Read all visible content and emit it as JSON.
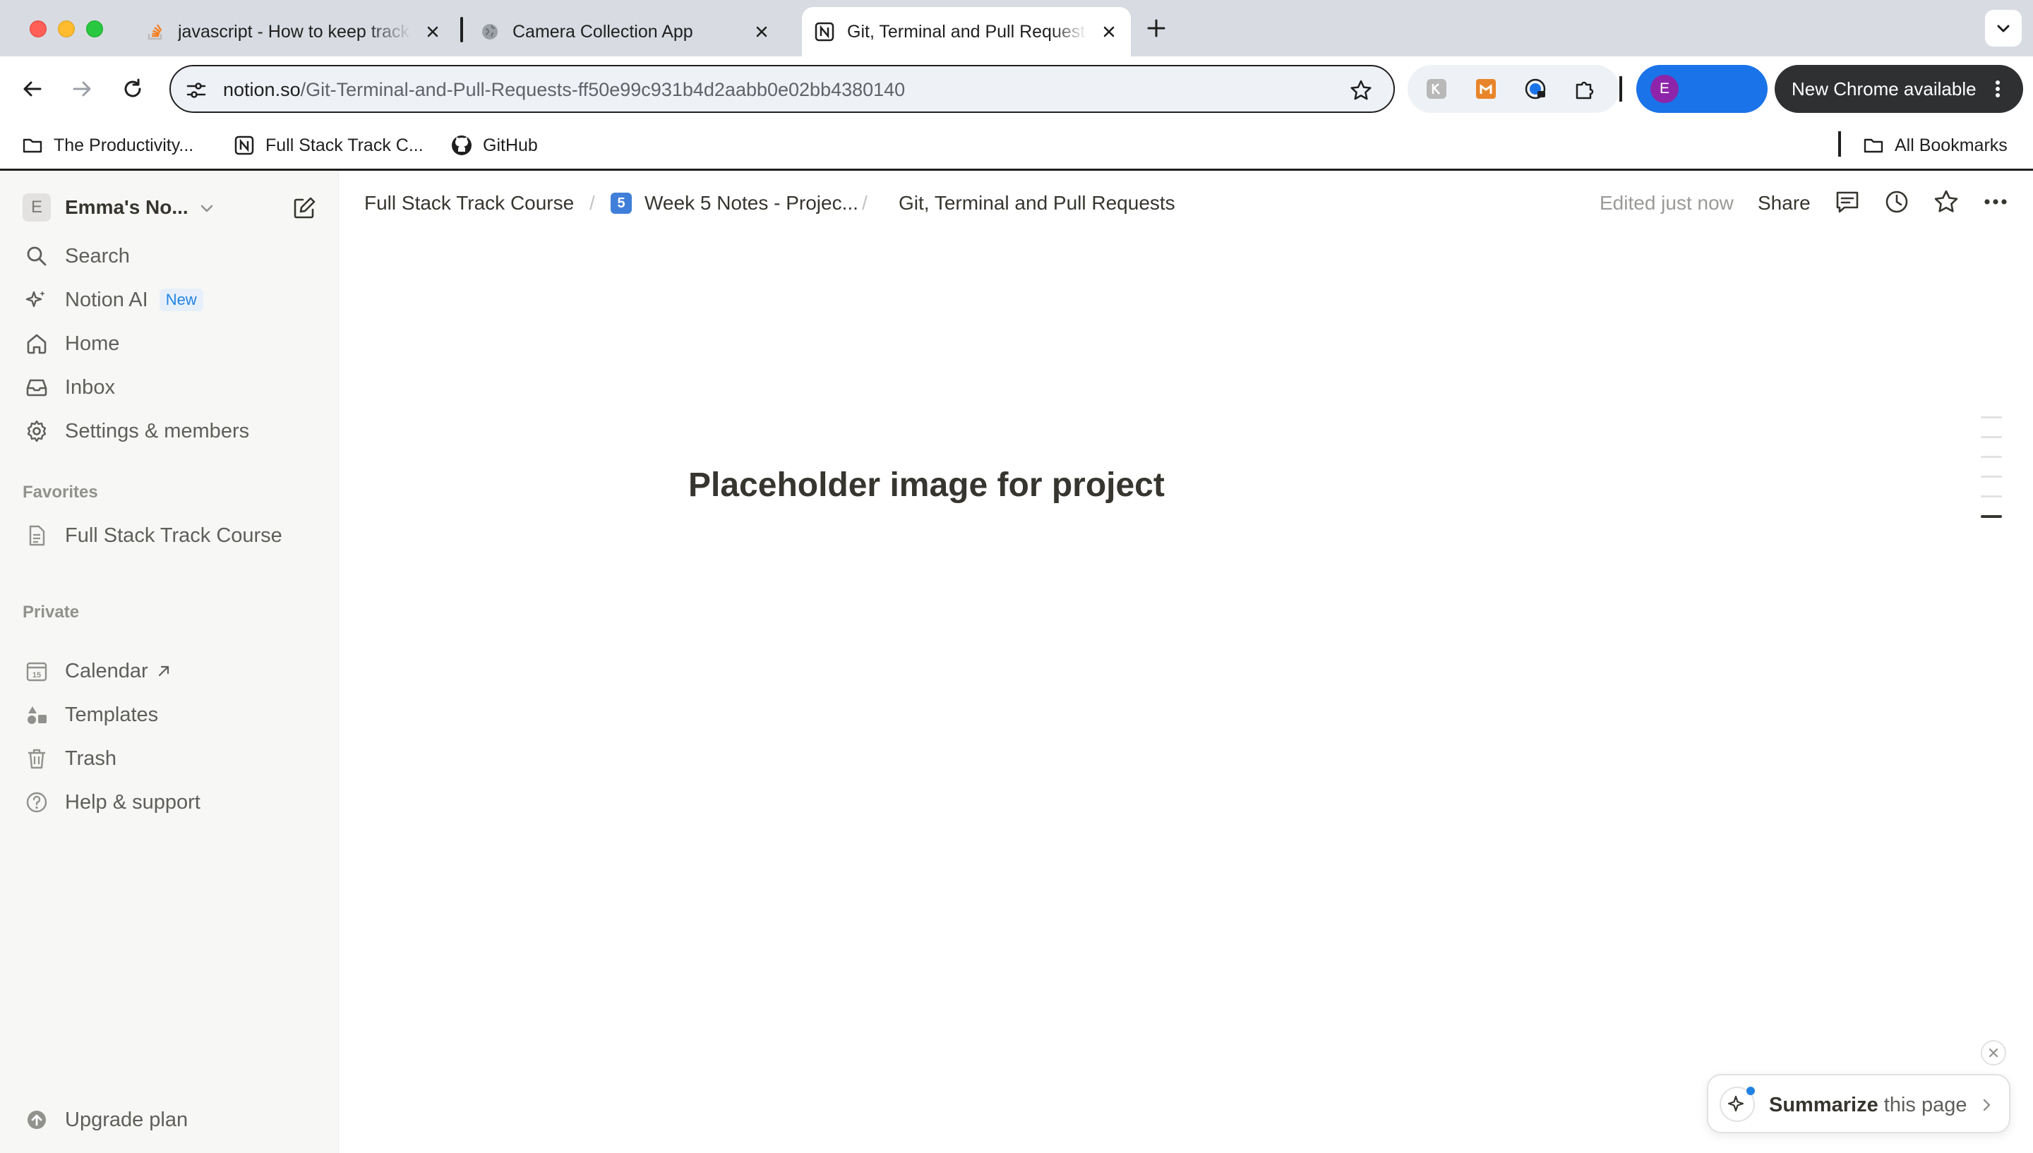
{
  "browser": {
    "tabs": [
      {
        "title": "javascript - How to keep track",
        "icon": "stackoverflow-icon"
      },
      {
        "title": "Camera Collection App",
        "icon": "globe-icon"
      },
      {
        "title": "Git, Terminal and Pull Requests",
        "icon": "notion-icon",
        "active": true
      }
    ],
    "url_host": "notion.so",
    "url_path": "/Git-Terminal-and-Pull-Requests-ff50e99c931b4d2aabb0e02bb4380140",
    "profile_initial": "E",
    "update_label": "New Chrome available",
    "bookmarks": [
      {
        "label": "The Productivity...",
        "icon": "folder-icon"
      },
      {
        "label": "Full Stack Track C...",
        "icon": "notion-icon"
      },
      {
        "label": "GitHub",
        "icon": "github-icon"
      }
    ],
    "all_bookmarks_label": "All Bookmarks"
  },
  "sidebar": {
    "workspace_initial": "E",
    "workspace_name": "Emma's No...",
    "nav": [
      {
        "label": "Search",
        "icon": "search-icon"
      },
      {
        "label": "Notion AI",
        "icon": "sparkle-icon",
        "badge": "New"
      },
      {
        "label": "Home",
        "icon": "home-icon"
      },
      {
        "label": "Inbox",
        "icon": "inbox-icon"
      },
      {
        "label": "Settings & members",
        "icon": "gear-icon"
      }
    ],
    "favorites_heading": "Favorites",
    "favorites": [
      {
        "label": "Full Stack Track Course",
        "icon": "page-icon"
      }
    ],
    "private_heading": "Private",
    "private": [
      {
        "label": "Calendar",
        "icon": "calendar-icon",
        "external": true
      },
      {
        "label": "Templates",
        "icon": "templates-icon"
      },
      {
        "label": "Trash",
        "icon": "trash-icon"
      },
      {
        "label": "Help & support",
        "icon": "help-icon"
      }
    ],
    "upgrade_label": "Upgrade plan"
  },
  "topbar": {
    "breadcrumbs": [
      {
        "label": "Full Stack Track Course"
      },
      {
        "label": "Week 5 Notes - Projec...",
        "emoji": "5"
      },
      {
        "label": "Git, Terminal and Pull Requests"
      }
    ],
    "separator": "/",
    "edited": "Edited just now",
    "share": "Share"
  },
  "page": {
    "heading": "Placeholder image for project"
  },
  "summarize": {
    "bold": "Summarize",
    "rest": " this page"
  },
  "colors": {
    "accent": "#2383e2",
    "profile_pill": "#1a73e8",
    "avatar": "#8e24aa",
    "sidebar_bg": "#f7f7f5"
  }
}
